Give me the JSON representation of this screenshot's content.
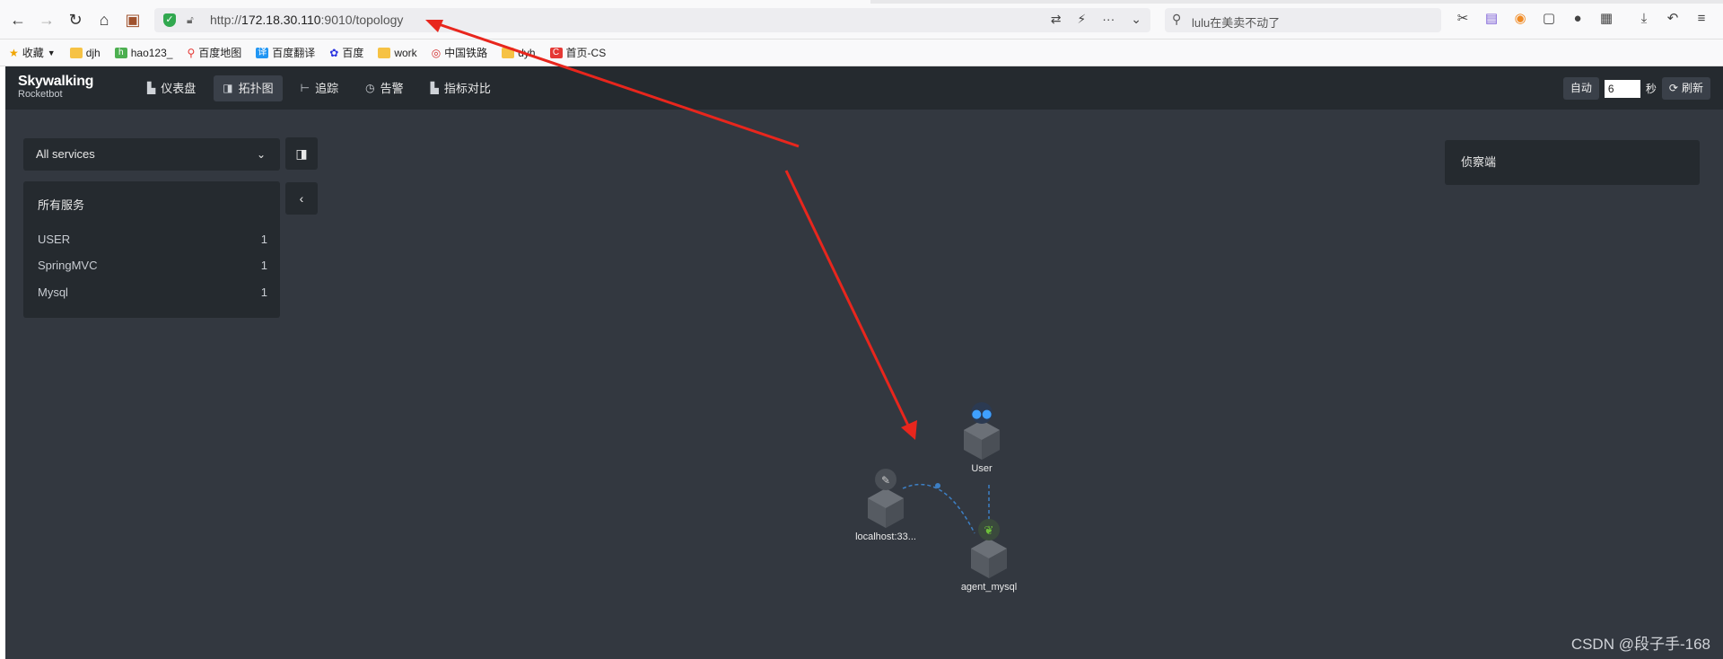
{
  "browser": {
    "url_prefix": "http://",
    "url_host": "172.18.30.110",
    "url_rest": ":9010/topology",
    "search_text": "lulu在美卖不动了"
  },
  "bookmarks": [
    {
      "label": "收藏",
      "icon": "star-icon"
    },
    {
      "label": "djh",
      "icon": "folder-icon"
    },
    {
      "label": "hao123_",
      "icon": "hao123-icon"
    },
    {
      "label": "百度地图",
      "icon": "map-pin-icon"
    },
    {
      "label": "百度翻译",
      "icon": "translate-icon"
    },
    {
      "label": "百度",
      "icon": "baidu-icon"
    },
    {
      "label": "work",
      "icon": "folder-icon"
    },
    {
      "label": "中国铁路",
      "icon": "rail-icon"
    },
    {
      "label": "dyh",
      "icon": "folder-icon"
    },
    {
      "label": "首页-CS",
      "icon": "csdn-icon"
    }
  ],
  "app": {
    "logo_title": "Skywalking",
    "logo_subtitle": "Rocketbot",
    "menu": [
      {
        "label": "仪表盘",
        "icon": "dashboard-icon",
        "active": false
      },
      {
        "label": "拓扑图",
        "icon": "topology-icon",
        "active": true
      },
      {
        "label": "追踪",
        "icon": "trace-icon",
        "active": false
      },
      {
        "label": "告警",
        "icon": "alarm-icon",
        "active": false
      },
      {
        "label": "指标对比",
        "icon": "compare-icon",
        "active": false
      }
    ],
    "auto_label": "自动",
    "auto_interval": "6",
    "seconds_label": "秒",
    "refresh_label": "刷新"
  },
  "services": {
    "select_value": "All services",
    "list_title": "所有服务",
    "rows": [
      {
        "name": "USER",
        "count": "1"
      },
      {
        "name": "SpringMVC",
        "count": "1"
      },
      {
        "name": "Mysql",
        "count": "1"
      }
    ]
  },
  "detector": {
    "title": "侦察端"
  },
  "topology": {
    "nodes": [
      {
        "label": "User",
        "badge": "users-icon"
      },
      {
        "label": "localhost:33...",
        "badge": "feather-icon"
      },
      {
        "label": "agent_mysql",
        "badge": "spring-leaf-icon"
      }
    ]
  },
  "watermark": "CSDN @段子手-168",
  "colors": {
    "app_bg": "#333840",
    "header_bg": "#252a2f",
    "panel_bg": "#252a2f",
    "annotation_arrow": "#e8261d",
    "link": "#3d7fc4"
  }
}
